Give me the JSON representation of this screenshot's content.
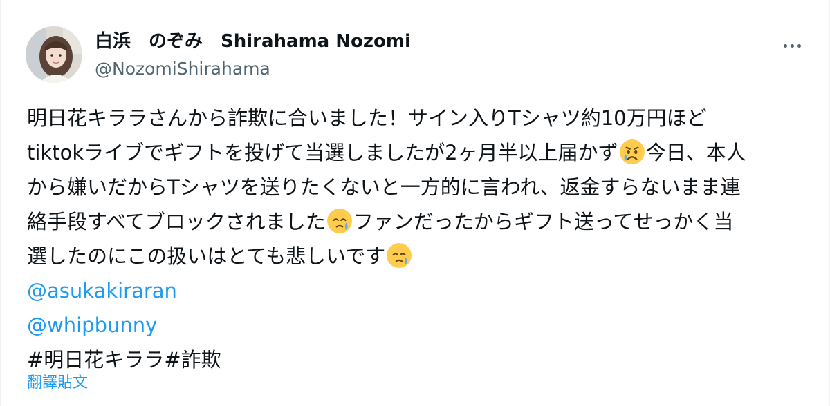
{
  "author": {
    "display_name": "白浜　のぞみ　Shirahama Nozomi",
    "handle": "@NozomiShirahama"
  },
  "more_icon": "more-horizontal-icon",
  "body": {
    "lines": [
      "明日花キララさんから詐欺に合いました！サイン入りTシャツ約10万円ほど",
      "tiktokライブでギフトを投げて当選しましたが2ヶ月半以上届かず",
      "今日、本人",
      "から嫌いだからTシャツを送りたくないと一方的に言われ、返金すらないまま連",
      "絡手段すべてブロックされました",
      "ファンだったからギフト送ってせっかく当",
      "選したのにこの扱いはとても悲しいです"
    ],
    "emojis": [
      "sad-relieved-face-icon",
      "face-holding-back-tears-icon",
      "face-holding-back-tears-icon"
    ],
    "mentions": [
      "@asukakiraran",
      "@whipbunny"
    ],
    "hashtags": [
      "#明日花キララ",
      "#詐欺"
    ]
  },
  "translate_label": "翻譯貼文",
  "colors": {
    "link": "#1d9bf0",
    "text": "#0f1419",
    "secondary": "#536471"
  }
}
